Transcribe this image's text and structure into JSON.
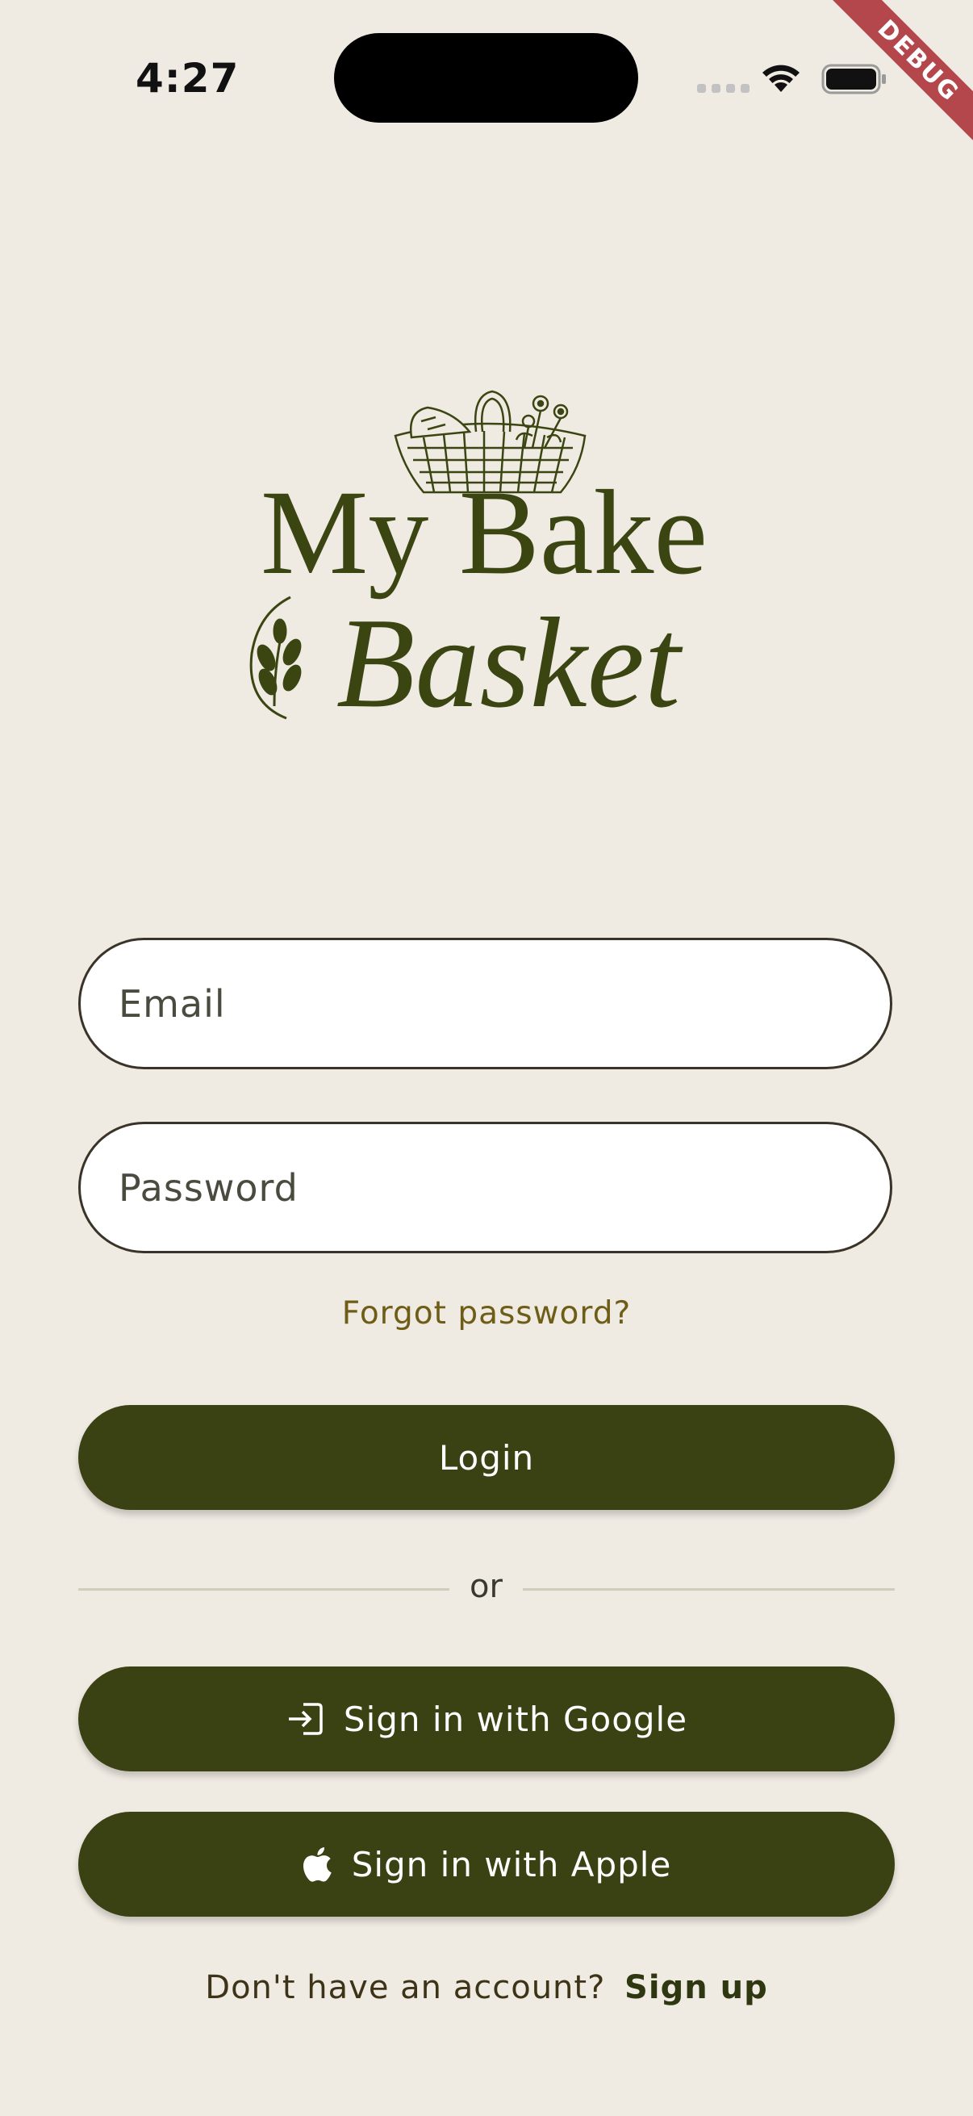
{
  "status_bar": {
    "time": "4:27"
  },
  "debug_banner": {
    "label": "DEBUG"
  },
  "logo": {
    "line1": "My Bake",
    "line2": "Basket",
    "icon": "basket-wheat-logo"
  },
  "form": {
    "email_placeholder": "Email",
    "email_value": "",
    "password_placeholder": "Password",
    "password_value": "",
    "forgot_label": "Forgot password?",
    "login_label": "Login"
  },
  "divider": {
    "label": "or"
  },
  "social": {
    "google_label": "Sign in with Google",
    "google_icon": "login-arrow-icon",
    "apple_label": "Sign in with Apple",
    "apple_icon": "apple-icon"
  },
  "signup": {
    "prompt": "Don't have an account?",
    "link_label": "Sign up"
  },
  "colors": {
    "background": "#efeae2",
    "primary_button": "#3a4112",
    "logo_green": "#3b4512",
    "link_gold": "#6d5d16",
    "debug_red": "#b4474c"
  }
}
